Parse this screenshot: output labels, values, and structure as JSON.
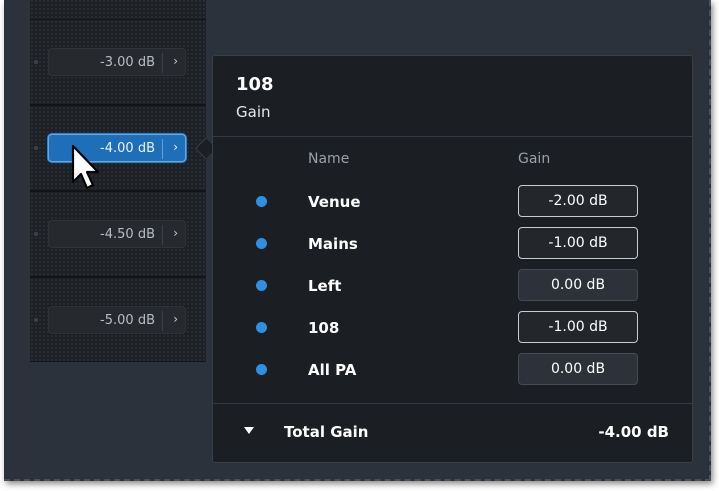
{
  "channel_strip": {
    "cells": [
      {
        "gain": "-3.00 dB",
        "chevron": "›",
        "active": false
      },
      {
        "gain": "-4.00 dB",
        "chevron": "›",
        "active": true
      },
      {
        "gain": "-4.50 dB",
        "chevron": "›",
        "active": false
      },
      {
        "gain": "-5.00 dB",
        "chevron": "›",
        "active": false
      }
    ]
  },
  "popover": {
    "title": "108",
    "subtitle": "Gain",
    "columns": {
      "name": "Name",
      "gain": "Gain"
    },
    "rows": [
      {
        "name": "Venue",
        "gain": "-2.00 dB"
      },
      {
        "name": "Mains",
        "gain": "-1.00 dB"
      },
      {
        "name": "Left",
        "gain": "0.00 dB"
      },
      {
        "name": "108",
        "gain": "-1.00 dB"
      },
      {
        "name": "All PA",
        "gain": "0.00 dB"
      }
    ],
    "total": {
      "label": "Total Gain",
      "value": "-4.00 dB"
    }
  },
  "colors": {
    "accent": "#1f6fb8",
    "bullet": "#2f8fe0",
    "background": "#2b323b",
    "panel": "#1b1e22"
  },
  "icons": {
    "chevron": "chevron-right-icon",
    "bullet": "blue-dot-icon",
    "collapse": "triangle-down-icon",
    "cursor": "mouse-pointer-icon"
  }
}
